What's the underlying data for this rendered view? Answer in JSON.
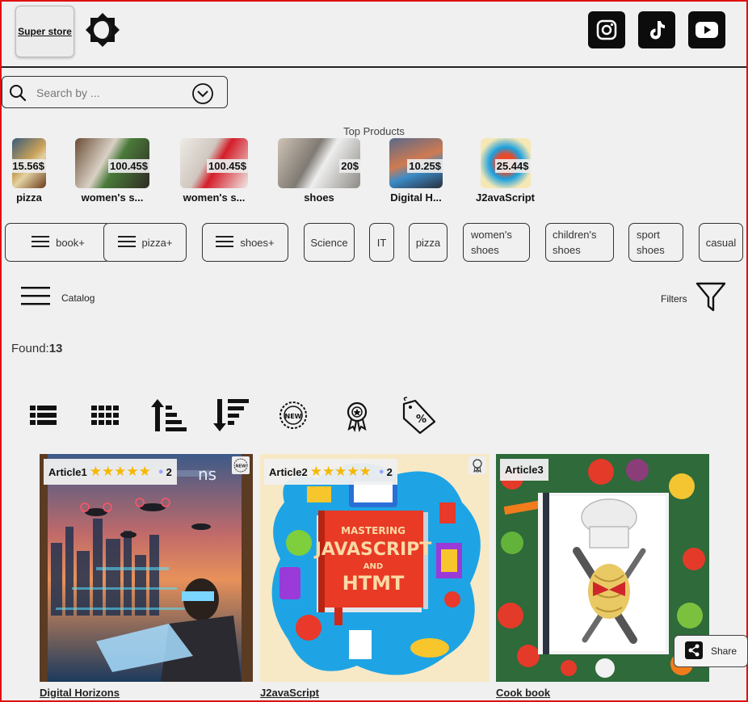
{
  "header": {
    "logo_label": "Super store",
    "social": [
      "instagram-icon",
      "tiktok-icon",
      "youtube-icon"
    ]
  },
  "search": {
    "placeholder": "Search by ..."
  },
  "top_products": {
    "title": "Top Products",
    "items": [
      {
        "name": "pizza",
        "price": "15.56$"
      },
      {
        "name": "women's s...",
        "price": "100.45$"
      },
      {
        "name": "women's s...",
        "price": "100.45$"
      },
      {
        "name": "shoes",
        "price": "20$"
      },
      {
        "name": "Digital H...",
        "price": "10.25$"
      },
      {
        "name": "J2avaScript",
        "price": "25.44$"
      }
    ]
  },
  "categories": [
    {
      "label": "book+",
      "menu": true
    },
    {
      "label": "pizza+",
      "menu": true
    },
    {
      "label": "shoes+",
      "menu": true
    },
    {
      "label": "Science"
    },
    {
      "label": "IT"
    },
    {
      "label": "pizza"
    },
    {
      "label": "women's shoes"
    },
    {
      "label": "children's shoes"
    },
    {
      "label": "sport shoes"
    },
    {
      "label": "casual"
    }
  ],
  "catalog_label": "Catalog",
  "filters_label": "Filters",
  "found": {
    "label": "Found:",
    "count": "13"
  },
  "toolbar": [
    "list-view-icon",
    "grid-view-icon",
    "sort-ascending-icon",
    "sort-descending-icon",
    "new-badge-icon",
    "award-icon",
    "discount-tag-icon"
  ],
  "cards": [
    {
      "article": "Article1",
      "rating": "★★★★★",
      "comments": "2",
      "title": "Digital Horizons",
      "badge": "new"
    },
    {
      "article": "Article2",
      "rating": "★★★★★",
      "comments": "2",
      "title": "J2avaScript",
      "badge": "award"
    },
    {
      "article": "Article3",
      "title": "Cook book"
    }
  ],
  "cover_text": {
    "js_line1": "MASTERING",
    "js_line2": "JAVASCRIPT",
    "js_line3": "AND",
    "js_line4": "HTMT",
    "digital_partial": "ns"
  },
  "share_label": "Share",
  "colors": {
    "frame": "#e01010",
    "stars": "#f5b800",
    "background": "#f0f0f0"
  }
}
